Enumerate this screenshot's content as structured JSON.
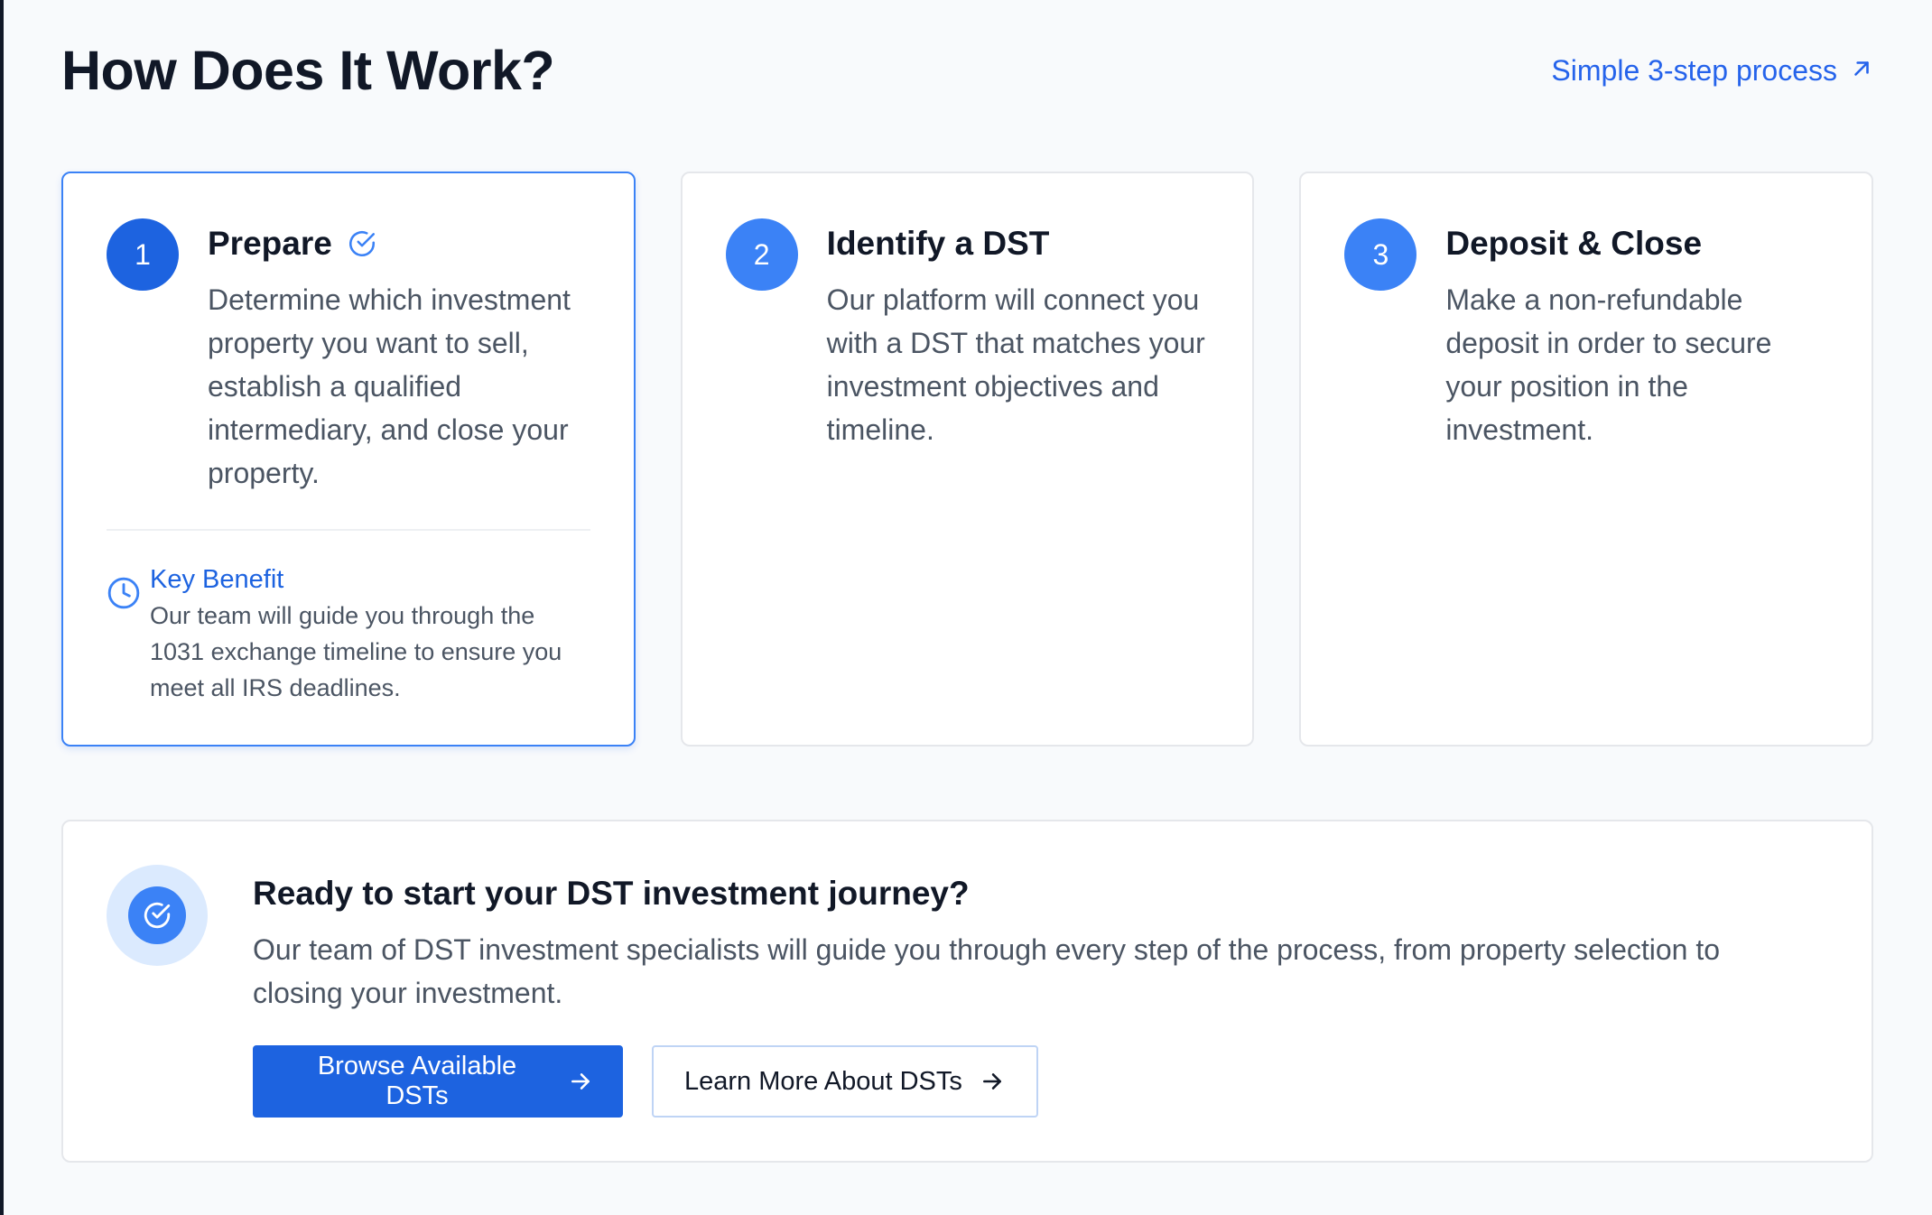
{
  "header": {
    "title": "How Does It Work?",
    "process_link": "Simple 3-step process"
  },
  "steps": [
    {
      "number": "1",
      "title": "Prepare",
      "description": "Determine which investment property you want to sell, establish a qualified intermediary, and close your property.",
      "completed": true,
      "benefit": {
        "title": "Key Benefit",
        "text": "Our team will guide you through the 1031 exchange timeline to ensure you meet all IRS deadlines."
      }
    },
    {
      "number": "2",
      "title": "Identify a DST",
      "description": "Our platform will connect you with a DST that matches your investment objectives and timeline."
    },
    {
      "number": "3",
      "title": "Deposit & Close",
      "description": "Make a non-refundable deposit in order to secure your position in the investment."
    }
  ],
  "cta": {
    "title": "Ready to start your DST investment journey?",
    "description": "Our team of DST investment specialists will guide you through every step of the process, from property selection to closing your investment.",
    "primary_button": "Browse Available DSTs",
    "secondary_button": "Learn More About DSTs"
  },
  "icons": {
    "process_link": "arrow-up-right-icon",
    "completed": "check-circle-icon",
    "benefit": "clock-icon",
    "cta_badge": "check-circle-icon",
    "button_arrow": "arrow-right-icon"
  },
  "colors": {
    "accent": "#1d63e0",
    "accent_light": "#3b82f6",
    "badge_bg": "#dbeafe",
    "text_primary": "#111827",
    "text_secondary": "#4b5563"
  }
}
